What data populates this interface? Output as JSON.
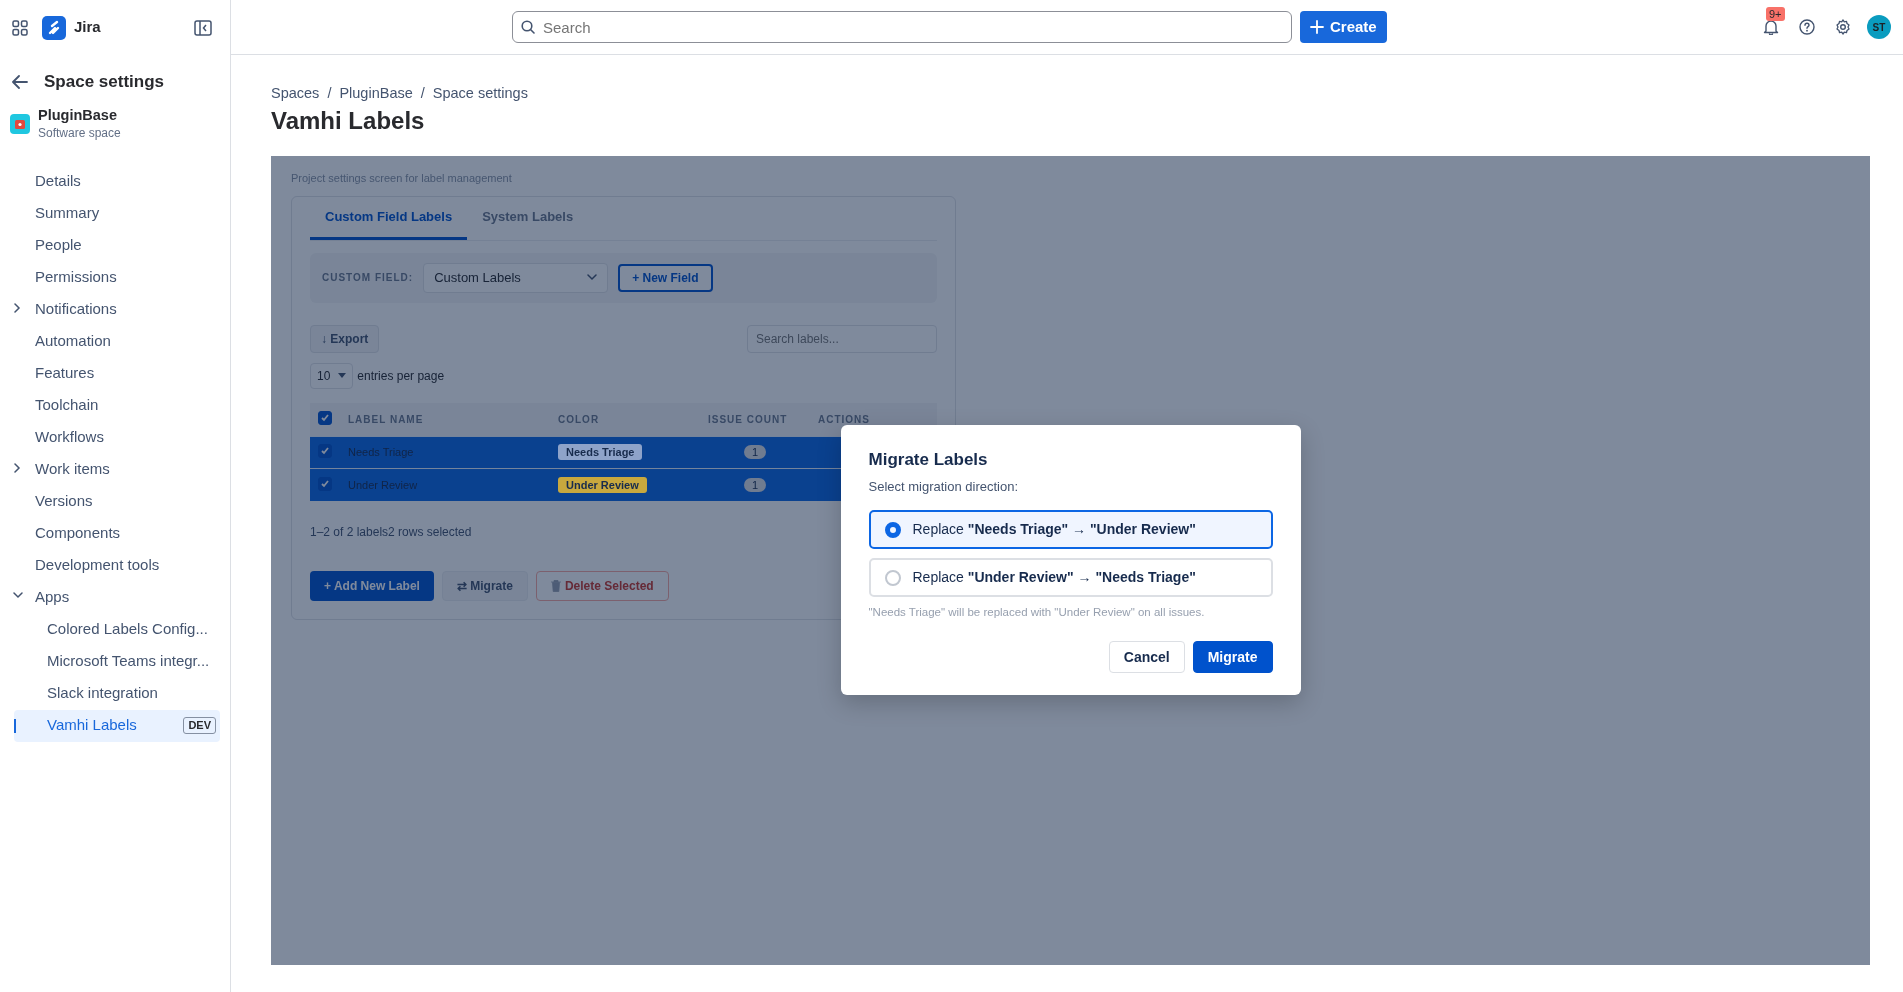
{
  "topbar": {
    "product": "Jira",
    "search": {
      "placeholder": "Search"
    },
    "create_button": "Create",
    "notification_count": "9+",
    "avatar": "ST"
  },
  "sidebar": {
    "title": "Space settings",
    "space": {
      "name": "PluginBase",
      "type": "Software space"
    },
    "items": [
      {
        "label": "Details",
        "kind": "link",
        "selected": false
      },
      {
        "label": "Summary",
        "kind": "link",
        "selected": false
      },
      {
        "label": "People",
        "kind": "link",
        "selected": false
      },
      {
        "label": "Permissions",
        "kind": "link",
        "selected": false
      },
      {
        "label": "Notifications",
        "kind": "group",
        "expanded": false,
        "selected": false
      },
      {
        "label": "Automation",
        "kind": "link",
        "selected": false
      },
      {
        "label": "Features",
        "kind": "link",
        "selected": false
      },
      {
        "label": "Toolchain",
        "kind": "link",
        "selected": false
      },
      {
        "label": "Workflows",
        "kind": "link",
        "selected": false
      },
      {
        "label": "Work items",
        "kind": "group",
        "expanded": false,
        "selected": false
      },
      {
        "label": "Versions",
        "kind": "link",
        "selected": false
      },
      {
        "label": "Components",
        "kind": "link",
        "selected": false
      },
      {
        "label": "Development tools",
        "kind": "link",
        "selected": false
      },
      {
        "label": "Apps",
        "kind": "group",
        "expanded": true,
        "selected": false,
        "children": [
          {
            "label": "Colored Labels Config...",
            "kind": "link",
            "selected": false
          },
          {
            "label": "Microsoft Teams integr...",
            "kind": "link",
            "selected": false
          },
          {
            "label": "Slack integration",
            "kind": "link",
            "selected": false
          },
          {
            "label": "Vamhi Labels",
            "kind": "link",
            "selected": true,
            "badge": "DEV"
          }
        ]
      }
    ]
  },
  "breadcrumbs": [
    "Spaces",
    "PluginBase",
    "Space settings"
  ],
  "breadcrumb_separators": [
    "/",
    "/"
  ],
  "page_title": "Vamhi Labels",
  "app": {
    "caption": "Project settings screen for label management",
    "tabs": [
      {
        "label": "Custom Field Labels",
        "selected": true
      },
      {
        "label": "System Labels",
        "selected": false
      }
    ],
    "custom_field": {
      "label": "CUSTOM FIELD:",
      "value": "Custom Labels"
    },
    "new_field_button": "+ New Field",
    "export_button": "↓ Export",
    "search": {
      "placeholder": "Search labels..."
    },
    "page_size": "10",
    "page_size_label": "entries per page",
    "table": {
      "select_all": true,
      "columns": [
        "LABEL NAME",
        "COLOR",
        "ISSUE COUNT",
        "ACTIONS"
      ],
      "rows": [
        {
          "checked": true,
          "selected": true,
          "name": "Needs Triage",
          "tag": "Needs Triage",
          "color": "#8ea3c9",
          "count": "1"
        },
        {
          "checked": true,
          "selected": true,
          "name": "Under Review",
          "tag": "Under Review",
          "color": "#c8a83e",
          "count": "1"
        }
      ]
    },
    "summary": "1–2 of 2 labels2 rows selected",
    "buttons": [
      {
        "label": "+ Add New Label",
        "kind": "primary"
      },
      {
        "label": "⇄ Migrate",
        "kind": "default"
      },
      {
        "label": "Delete Selected",
        "kind": "danger"
      }
    ]
  },
  "modal": {
    "title": "Migrate Labels",
    "subtitle": "Select migration direction:",
    "options": [
      {
        "label": "Replace **\"Needs Triage\"** → **\"Under Review\"**",
        "selected": true
      },
      {
        "label": "Replace **\"Under Review\"** → **\"Needs Triage\"**",
        "selected": false
      }
    ],
    "hint": "\"Needs Triage\" will be replaced with \"Under Review\" on all issues.",
    "buttons": [
      {
        "label": "Cancel",
        "kind": "default"
      },
      {
        "label": "Migrate",
        "kind": "primary"
      }
    ]
  }
}
